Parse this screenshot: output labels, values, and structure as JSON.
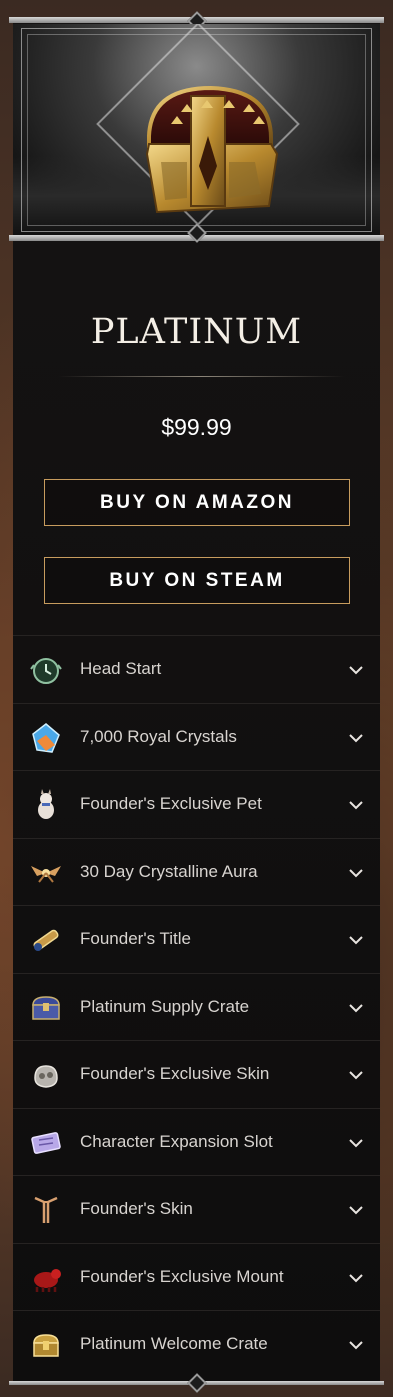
{
  "tier": {
    "name": "PLATINUM",
    "price": "$99.99"
  },
  "actions": {
    "amazon_label": "BUY ON AMAZON",
    "steam_label": "BUY ON STEAM"
  },
  "features": [
    {
      "label": "Head Start",
      "icon": "clock-icon"
    },
    {
      "label": "7,000 Royal Crystals",
      "icon": "crystal-icon"
    },
    {
      "label": "Founder's Exclusive Pet",
      "icon": "pet-icon"
    },
    {
      "label": "30 Day Crystalline Aura",
      "icon": "aura-icon"
    },
    {
      "label": "Founder's Title",
      "icon": "scroll-icon"
    },
    {
      "label": "Platinum Supply Crate",
      "icon": "crate-icon"
    },
    {
      "label": "Founder's Exclusive Skin",
      "icon": "skin-icon"
    },
    {
      "label": "Character Expansion Slot",
      "icon": "ticket-icon"
    },
    {
      "label": "Founder's Skin",
      "icon": "emblem-icon"
    },
    {
      "label": "Founder's Exclusive Mount",
      "icon": "mount-icon"
    },
    {
      "label": "Platinum Welcome Crate",
      "icon": "welcome-crate-icon"
    }
  ],
  "colors": {
    "button_border": "#c79c5e",
    "card_bg": "#151313",
    "text_primary": "#ffffff",
    "text_feature": "#d8d4d0"
  }
}
